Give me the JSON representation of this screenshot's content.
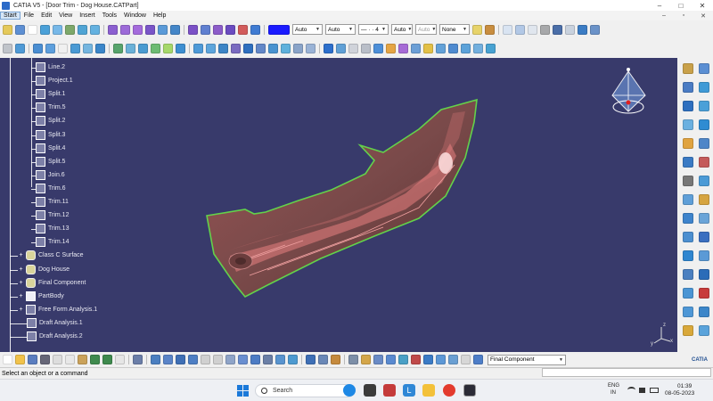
{
  "window": {
    "title": "CATIA V5 - [Door Trim - Dog House.CATPart]",
    "controls": [
      "–",
      "□",
      "✕"
    ]
  },
  "menu": {
    "items": [
      "Start",
      "File",
      "Edit",
      "View",
      "Insert",
      "Tools",
      "Window",
      "Help"
    ],
    "right_controls": [
      "–",
      "▫",
      "✕"
    ]
  },
  "toolbar": {
    "color_swatch": "#1a1aff",
    "linetype_combo": "Auto",
    "thickness_combo": "Auto",
    "dash_combo": "— · · 4",
    "auto_combo_1": "Auto",
    "auto_combo_2": "Auto",
    "layer_combo": "None",
    "component_combo": "Final Component"
  },
  "tree": {
    "items": [
      {
        "label": "Line.2",
        "icon": "line-icon"
      },
      {
        "label": "Project.1",
        "icon": "project-icon"
      },
      {
        "label": "Split.1",
        "icon": "split-icon"
      },
      {
        "label": "Trim.5",
        "icon": "trim-icon"
      },
      {
        "label": "Split.2",
        "icon": "split-icon"
      },
      {
        "label": "Split.3",
        "icon": "split-icon"
      },
      {
        "label": "Split.4",
        "icon": "split-icon"
      },
      {
        "label": "Split.5",
        "icon": "split-icon"
      },
      {
        "label": "Join.6",
        "icon": "join-icon"
      },
      {
        "label": "Trim.6",
        "icon": "trim-icon"
      },
      {
        "label": "Trim.11",
        "icon": "trim-icon"
      },
      {
        "label": "Trim.12",
        "icon": "trim-icon"
      },
      {
        "label": "Trim.13",
        "icon": "trim-icon"
      },
      {
        "label": "Trim.14",
        "icon": "trim-icon"
      },
      {
        "label": "Class C Surface",
        "icon": "geometric-set-icon"
      },
      {
        "label": "Dog House",
        "icon": "geometric-set-icon"
      },
      {
        "label": "Final Component",
        "icon": "geometric-set-icon"
      },
      {
        "label": "PartBody",
        "icon": "partbody-icon"
      },
      {
        "label": "Free Form Analysis.1",
        "icon": "analysis-icon"
      },
      {
        "label": "Draft Analysis.1",
        "icon": "draft-analysis-icon"
      },
      {
        "label": "Draft Analysis.2",
        "icon": "draft-analysis-icon"
      }
    ]
  },
  "colors": {
    "viewport_bg": "#383a6b",
    "part_fill": "#7a4a4a",
    "part_highlight": "#e87f7f",
    "part_edge": "#63d24a"
  },
  "compass": {
    "axes": [
      "x",
      "y",
      "z"
    ]
  },
  "status": {
    "message": "Select an object or a command"
  },
  "taskbar": {
    "search_placeholder": "Search",
    "lang_line1": "ENG",
    "lang_line2": "IN",
    "time": "01:39",
    "date": "08-05-2023"
  }
}
